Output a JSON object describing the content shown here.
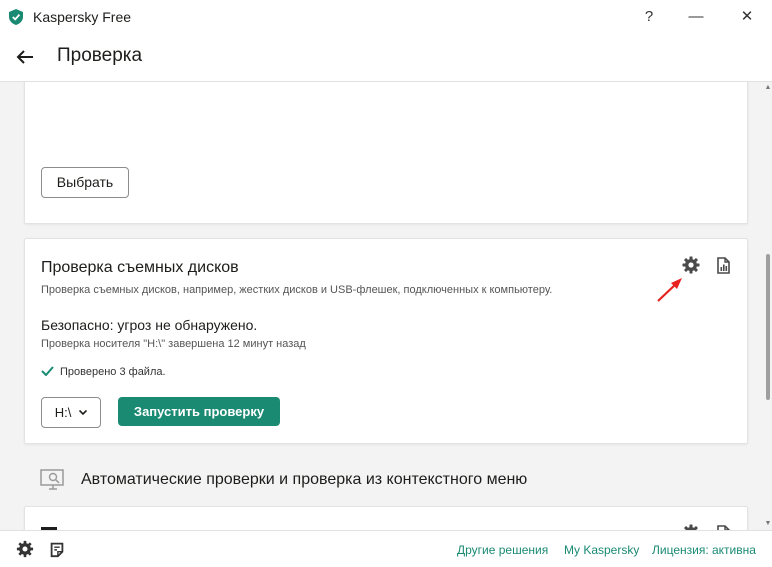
{
  "window": {
    "title": "Kaspersky Free",
    "help_glyph": "?",
    "minimize_glyph": "—",
    "close_glyph": "✕"
  },
  "header": {
    "title": "Проверка",
    "back_icon": "arrow-left-icon"
  },
  "top_card": {
    "choose_button": "Выбрать"
  },
  "removable_scan": {
    "title": "Проверка съемных дисков",
    "description": "Проверка съемных дисков, например, жестких дисков и USB-флешек, подключенных к компьютеру.",
    "status": "Безопасно: угроз не обнаружено.",
    "last_scan": "Проверка носителя \"H:\\\" завершена 12 минут назад",
    "checked": "Проверено 3 файла.",
    "drive": "H:\\",
    "start_button": "Запустить проверку",
    "settings_icon": "gear-icon",
    "report_icon": "report-icon"
  },
  "auto_section": {
    "title": "Автоматические проверки и проверка из контекстного меню",
    "icon": "monitor-icon"
  },
  "footer": {
    "other_solutions": "Другие решения",
    "my_kaspersky": "My Kaspersky",
    "license": "Лицензия: активна"
  },
  "colors": {
    "accent": "#1a8a73",
    "annotation": "#e8201e",
    "background": "#f3f3f3"
  }
}
